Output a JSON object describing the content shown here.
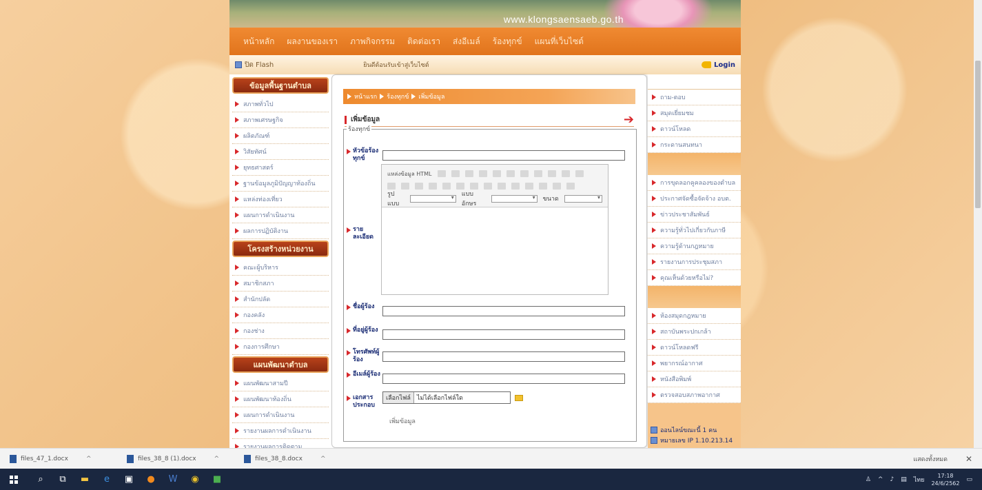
{
  "banner": {
    "url": "www.klongsaensaeb.go.th"
  },
  "nav": {
    "items": [
      "หน้าหลัก",
      "ผลงานของเรา",
      "ภาพกิจกรรม",
      "ติดต่อเรา",
      "ส่งอีเมล์",
      "ร้องทุกข์",
      "แผนที่เว็บไซต์"
    ]
  },
  "topstrip": {
    "flash_label": "ปิด Flash",
    "marquee": "ยินดีต้อนรับเข้าสู่เว็บไซต์",
    "login_label": "Login"
  },
  "left_sidebar": {
    "section1_title": "ข้อมูลพื้นฐานตำบล",
    "section1_items": [
      "สภาพทั่วไป",
      "สภาพเศรษฐกิจ",
      "ผลิตภัณฑ์",
      "วิสัยทัศน์",
      "ยุทธศาสตร์",
      "ฐานข้อมูลภูมิปัญญาท้องถิ่น",
      "แหล่งท่องเที่ยว",
      "แผนการดำเนินงาน",
      "ผลการปฏิบัติงาน"
    ],
    "section2_title": "โครงสร้างหน่วยงาน",
    "section2_items": [
      "คณะผู้บริหาร",
      "สมาชิกสภา",
      "สำนักปลัด",
      "กองคลัง",
      "กองช่าง",
      "กองการศึกษา"
    ],
    "section3_title": "แผนพัฒนาตำบล",
    "section3_items": [
      "แผนพัฒนาสามปี",
      "แผนพัฒนาท้องถิ่น",
      "แผนการดำเนินงาน",
      "รายงานผลการดำเนินงาน",
      "รายงานผลการติดตาม"
    ]
  },
  "main": {
    "breadcrumb": [
      "หน้าแรก",
      "ร้องทุกข์",
      "เพิ่มข้อมูล"
    ],
    "heading": "เพิ่มข้อมูล",
    "legend": "ร้องทุกข์",
    "labels": {
      "subject": "หัวข้อร้องทุกข์",
      "detail": "รายละเอียด",
      "name": "ชื่อผู้ร้อง",
      "address": "ที่อยู่ผู้ร้อง",
      "phone": "โทรศัพท์ผู้ร้อง",
      "email": "อีเมล์ผู้ร้อง",
      "attachment": "เอกสารประกอบ"
    },
    "editor": {
      "source_label": "แหล่งข้อมูล HTML",
      "format_label": "รูปแบบ",
      "font_label": "แบบอักษร",
      "size_label": "ขนาด"
    },
    "file_button": "เลือกไฟล์",
    "file_status": "ไม่ได้เลือกไฟล์ใด",
    "submit_label": "เพิ่มข้อมูล"
  },
  "right_sidebar": {
    "group1": [
      "ถาม-ตอบ",
      "สมุดเยี่ยมชม",
      "ดาวน์โหลด",
      "กระดานสนทนา"
    ],
    "group2": [
      "การขุดลอกคูคลองของตำบล",
      "ประกาศจัดซื้อจัดจ้าง อบต.",
      "ข่าวประชาสัมพันธ์",
      "ความรู้ทั่วไปเกี่ยวกับภาษี",
      "ความรู้ด้านกฎหมาย",
      "รายงานการประชุมสภา",
      "คุณเห็นด้วยหรือไม่?"
    ],
    "group3": [
      "ห้องสมุดกฎหมาย",
      "สถาบันพระปกเกล้า",
      "ดาวน์โหลดฟรี",
      "พยากรณ์อากาศ",
      "หนังสือพิมพ์",
      "ตรวจสอบสภาพอากาศ"
    ],
    "online_text": "ออนไลน์ขณะนี้ 1 คน",
    "ip_text": "หมายเลข IP 1.10.213.14"
  },
  "downloads": {
    "files": [
      "files_47_1.docx",
      "files_38_8 (1).docx",
      "files_38_8.docx"
    ],
    "show_all": "แสดงทั้งหมด"
  },
  "taskbar": {
    "time": "17:18",
    "date": "24/6/2562",
    "lang": "ไทย"
  }
}
